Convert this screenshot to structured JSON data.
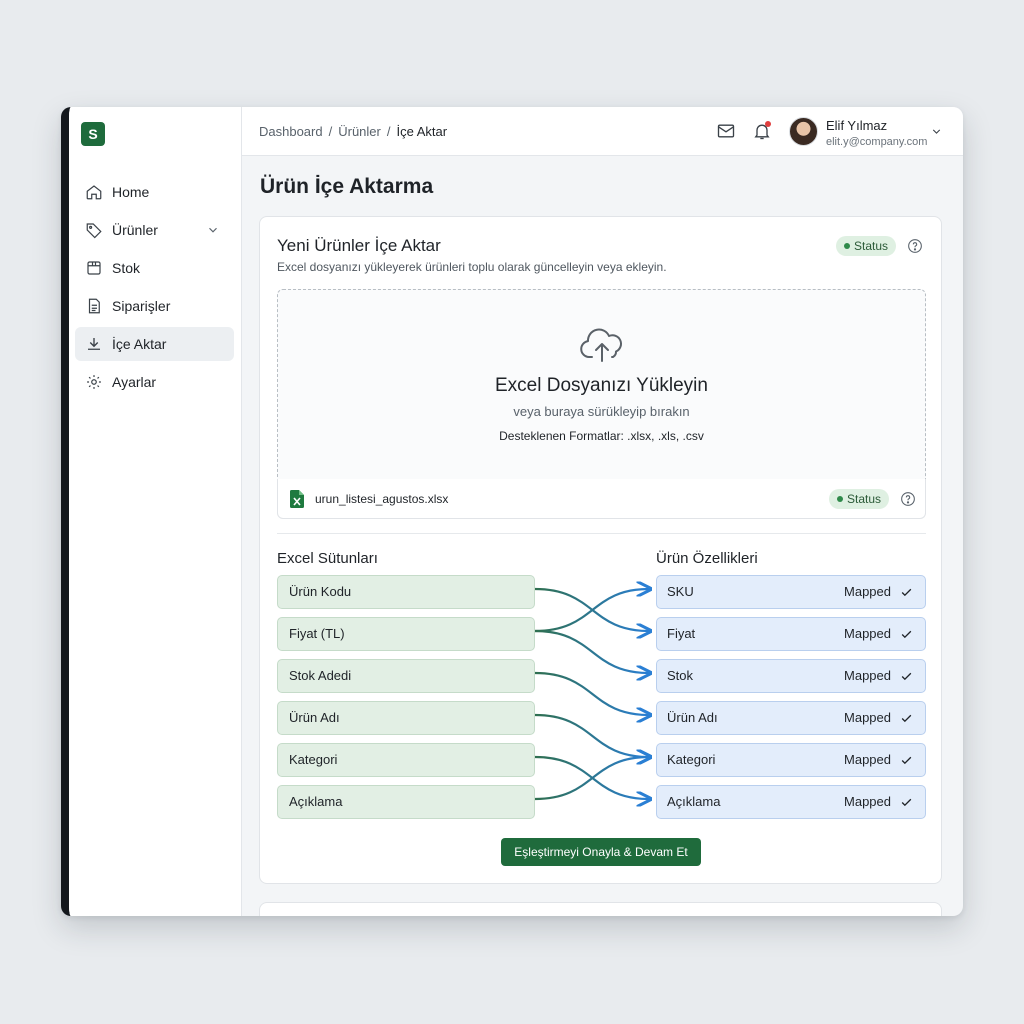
{
  "sidebar": {
    "logo": "S",
    "items": [
      {
        "label": "Home"
      },
      {
        "label": "Ürünler"
      },
      {
        "label": "Stok"
      },
      {
        "label": "Siparişler"
      },
      {
        "label": "İçe Aktar"
      },
      {
        "label": "Ayarlar"
      }
    ]
  },
  "header": {
    "breadcrumb": [
      "Dashboard",
      "/",
      "Ürünler",
      "/",
      "İçe Aktar"
    ],
    "user_name": "Elif Yılmaz",
    "user_email": "elit.y@company.com"
  },
  "main": {
    "page_title": "Ürün İçe Aktarma",
    "card_title": "Yeni Ürünler İçe Aktar",
    "card_subtitle": "Excel dosyanızı yükleyerek ürünleri toplu olarak güncelleyin veya ekleyin.",
    "status_label": "Status",
    "upload": {
      "title": "Excel Dosyanızı Yükleyin",
      "subtitle": "veya buraya sürükleyip bırakın",
      "formats": "Desteklenen Formatlar: .xlsx, .xls, .csv"
    },
    "file": {
      "name": "urun_listesi_agustos.xlsx",
      "status": "Status"
    },
    "mapping": {
      "source_header": "Excel Sütunları",
      "target_header": "Ürün Özellikleri",
      "source_columns": [
        "Ürün Kodu",
        "Fiyat (TL)",
        "Stok Adedi",
        "Ürün Adı",
        "Kategori",
        "Açıklama"
      ],
      "target_fields": [
        "SKU",
        "Fiyat",
        "Stok",
        "Ürün Adı",
        "Kategori",
        "Açıklama"
      ],
      "mapped_label": "Mapped"
    },
    "confirm_button": "Eşleştirmeyi Onayla & Devam Et"
  },
  "colors": {
    "brand": "#1e6b3c",
    "source_fill": "#e2efe4",
    "target_fill": "#e3edfb",
    "connector_start": "#2f7a4d",
    "connector_end": "#2a7fd4"
  }
}
